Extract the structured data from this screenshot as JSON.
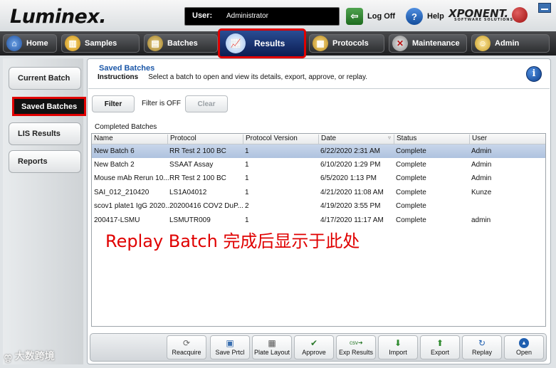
{
  "app": {
    "logo": "Luminex.",
    "brand": "XPONENT.",
    "brand_sub": "SOFTWARE SOLUTIONS"
  },
  "topbar": {
    "user_label": "User:",
    "user_value": "Administrator",
    "logoff_label": "Log Off",
    "help_label": "Help"
  },
  "nav": {
    "tabs": [
      {
        "label": "Home",
        "icon": "home-icon"
      },
      {
        "label": "Samples",
        "icon": "samples-icon"
      },
      {
        "label": "Batches",
        "icon": "batches-icon"
      },
      {
        "label": "Results",
        "icon": "results-chart-icon",
        "active": true
      },
      {
        "label": "Protocols",
        "icon": "protocols-icon"
      },
      {
        "label": "Maintenance",
        "icon": "maintenance-tools-icon"
      },
      {
        "label": "Admin",
        "icon": "admin-user-icon"
      }
    ]
  },
  "sidebar": {
    "items": [
      {
        "label": "Current Batch"
      },
      {
        "label": "Saved Batches",
        "active": true
      },
      {
        "label": "LIS Results"
      },
      {
        "label": "Reports"
      }
    ]
  },
  "watermark": "大数跨境",
  "main": {
    "section_title": "Saved Batches",
    "instructions_label": "Instructions",
    "instructions_text": "Select a batch to open and view its details, export, approve, or replay.",
    "filter_button": "Filter",
    "filter_status": "Filter is OFF",
    "clear_button": "Clear",
    "table_label": "Completed Batches",
    "columns": [
      "Name",
      "Protocol",
      "Protocol Version",
      "Date",
      "Status",
      "User"
    ],
    "rows": [
      [
        "New Batch 6",
        "RR Test 2 100 BC",
        "1",
        "6/22/2020 2:31 AM",
        "Complete",
        "Admin"
      ],
      [
        "New Batch 2",
        "SSAAT Assay",
        "1",
        "6/10/2020 1:29 PM",
        "Complete",
        "Admin"
      ],
      [
        "Mouse mAb Rerun 10...",
        "RR Test 2 100 BC",
        "1",
        "6/5/2020 1:13 PM",
        "Complete",
        "Admin"
      ],
      [
        "SAI_012_210420",
        "LS1A04012",
        "1",
        "4/21/2020 11:08 AM",
        "Complete",
        "Kunze"
      ],
      [
        "scov1 plate1 IgG 2020...",
        "20200416 COV2 DuP...",
        "2",
        "4/19/2020 3:55 PM",
        "Complete",
        ""
      ],
      [
        "200417-LSMU",
        "LSMUTR009",
        "1",
        "4/17/2020 11:17 AM",
        "Complete",
        "admin"
      ]
    ],
    "annotation": "Replay Batch 完成后显示于此处"
  },
  "toolbar": {
    "buttons": [
      {
        "label": "Reacquire",
        "icon": "reacquire-icon"
      },
      {
        "label": "Save Prtcl",
        "icon": "save-protocol-icon"
      },
      {
        "label": "Plate Layout",
        "icon": "plate-layout-icon"
      },
      {
        "label": "Approve",
        "icon": "approve-icon"
      },
      {
        "label": "Exp Results",
        "icon": "export-results-csv-icon"
      },
      {
        "label": "Import",
        "icon": "import-icon"
      },
      {
        "label": "Export",
        "icon": "export-icon"
      },
      {
        "label": "Replay",
        "icon": "replay-icon"
      },
      {
        "label": "Open",
        "icon": "open-icon"
      }
    ]
  },
  "colors": {
    "accent_red": "#e00000",
    "selected_row": "#b8cbe5",
    "title_blue": "#1b57a8"
  }
}
